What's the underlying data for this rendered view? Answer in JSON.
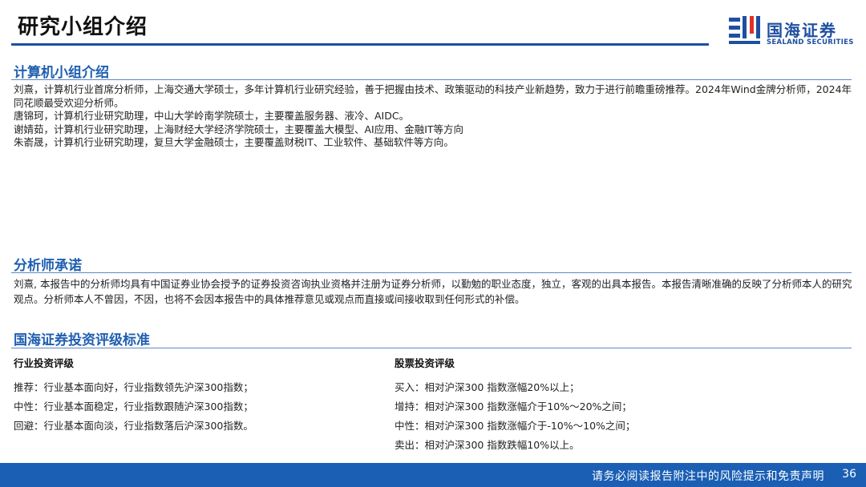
{
  "header": {
    "title": "研究小组介绍",
    "logo": {
      "cn": "国海证券",
      "en": "SEALAND SECURITIES"
    }
  },
  "sections": {
    "team": {
      "title": "计算机小组介绍",
      "members": [
        "刘熹，计算机行业首席分析师，上海交通大学硕士，多年计算机行业研究经验，善于把握由技术、政策驱动的科技产业新趋势，致力于进行前瞻重磅推荐。2024年Wind金牌分析师，2024年同花顺最受欢迎分析师。",
        "唐锦珂，计算机行业研究助理，中山大学岭南学院硕士，主要覆盖服务器、液冷、AIDC。",
        "谢婧茹，计算机行业研究助理，上海财经大学经济学院硕士，主要覆盖大模型、AI应用、金融IT等方向",
        "朱嵛晟，计算机行业研究助理，复旦大学金融硕士，主要覆盖财税IT、工业软件、基础软件等方向。"
      ]
    },
    "commitment": {
      "title": "分析师承诺",
      "text": "刘熹, 本报告中的分析师均具有中国证券业协会授予的证券投资咨询执业资格并注册为证券分析师，以勤勉的职业态度，独立，客观的出具本报告。本报告清晰准确的反映了分析师本人的研究观点。分析师本人不曾因，不因，也将不会因本报告中的具体推荐意见或观点而直接或间接收取到任何形式的补偿。"
    },
    "ratings": {
      "title": "国海证券投资评级标准",
      "industry": {
        "title": "行业投资评级",
        "items": [
          "推荐：行业基本面向好，行业指数领先沪深300指数；",
          "中性：行业基本面稳定，行业指数跟随沪深300指数；",
          "回避：行业基本面向淡，行业指数落后沪深300指数。"
        ]
      },
      "stock": {
        "title": "股票投资评级",
        "items": [
          "买入：相对沪深300 指数涨幅20%以上；",
          "增持：相对沪深300 指数涨幅介于10%～20%之间；",
          "中性：相对沪深300 指数涨幅介于-10%～10%之间；",
          "卖出：相对沪深300 指数跌幅10%以上。"
        ]
      }
    }
  },
  "footer": {
    "text": "请务必阅读报告附注中的风险提示和免责声明",
    "page": "36"
  },
  "colors": {
    "brand": "#1f4fa0",
    "section_title": "#1f5fb0",
    "footer_bg": "#1a5fb4",
    "logo_red": "#e0312b"
  }
}
